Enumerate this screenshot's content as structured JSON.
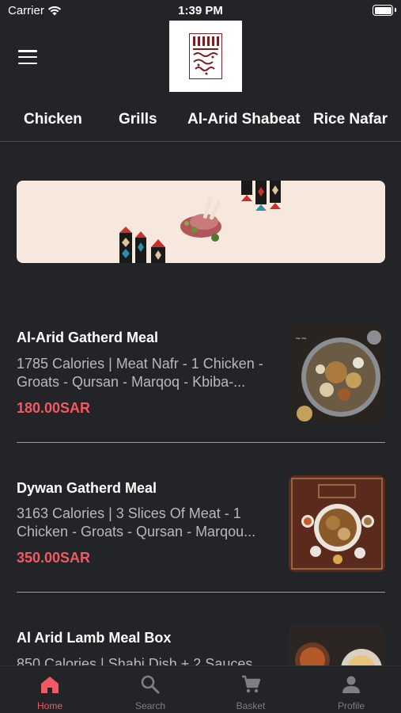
{
  "status": {
    "carrier": "Carrier",
    "time": "1:39 PM"
  },
  "header": {
    "logo_alt": "restaurant-logo"
  },
  "categories": [
    {
      "label": "Chicken"
    },
    {
      "label": "Grills"
    },
    {
      "label": "Al-Arid Shabeat"
    },
    {
      "label": "Rice Nafar"
    }
  ],
  "meals": [
    {
      "name": "Al-Arid Gatherd Meal",
      "desc": "1785 Calories | Meat Nafr - 1 Chicken - Groats - Qursan - Marqoq - Kbiba-...",
      "price": "180.00SAR"
    },
    {
      "name": "Dywan Gatherd Meal",
      "desc": "3163 Calories | 3 Slices Of Meat - 1 Chicken - Groats - Qursan - Marqou...",
      "price": "350.00SAR"
    },
    {
      "name": "Al Arid Lamb Meal Box",
      "desc": "850 Calories | Shabi Dish + 2 Sauces",
      "price": ""
    }
  ],
  "tabs": [
    {
      "label": "Home",
      "icon": "home-icon",
      "active": true
    },
    {
      "label": "Search",
      "icon": "search-icon",
      "active": false
    },
    {
      "label": "Basket",
      "icon": "cart-icon",
      "active": false
    },
    {
      "label": "Profile",
      "icon": "profile-icon",
      "active": false
    }
  ],
  "colors": {
    "accent": "#ef5a63",
    "background": "#232427",
    "banner": "#f6e8dc"
  }
}
